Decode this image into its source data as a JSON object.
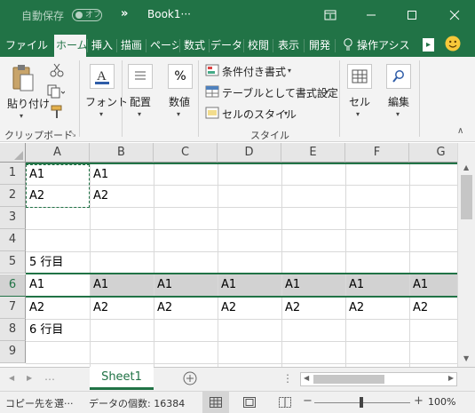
{
  "title_bar": {
    "autosave_label": "自動保存",
    "autosave_state": "オフ",
    "more_label": "»",
    "filename": "Book1···"
  },
  "tabs": [
    "ファイル",
    "ホーム",
    "挿入",
    "描画",
    "ページ",
    "数式",
    "データ",
    "校閲",
    "表示",
    "開発",
    "操作アシス"
  ],
  "ribbon": {
    "paste_label": "貼り付け",
    "font_label": "フォント",
    "align_label": "配置",
    "number_label": "数値",
    "number_icon": "%",
    "cond_format": "条件付き書式",
    "table_format": "テーブルとして書式設定",
    "cell_style": "セルのスタイル",
    "cell_label": "セル",
    "edit_label": "編集",
    "group_clipboard": "クリップボード",
    "group_style": "スタイル"
  },
  "columns": [
    "A",
    "B",
    "C",
    "D",
    "E",
    "F",
    "G"
  ],
  "rows": [
    "1",
    "2",
    "3",
    "4",
    "5",
    "6",
    "7",
    "8",
    "9"
  ],
  "cells": {
    "r1": [
      "A1",
      "A1",
      "",
      "",
      "",
      "",
      ""
    ],
    "r2": [
      "A2",
      "A2",
      "",
      "",
      "",
      "",
      ""
    ],
    "r3": [
      "",
      "",
      "",
      "",
      "",
      "",
      ""
    ],
    "r4": [
      "",
      "",
      "",
      "",
      "",
      "",
      ""
    ],
    "r5": [
      "5 行目",
      "",
      "",
      "",
      "",
      "",
      ""
    ],
    "r6": [
      "A1",
      "A1",
      "A1",
      "A1",
      "A1",
      "A1",
      "A1"
    ],
    "r7": [
      "A2",
      "A2",
      "A2",
      "A2",
      "A2",
      "A2",
      "A2"
    ],
    "r8": [
      "6 行目",
      "",
      "",
      "",
      "",
      "",
      ""
    ],
    "r9": [
      "",
      "",
      "",
      "",
      "",
      "",
      ""
    ]
  },
  "sheet_tab": "Sheet1",
  "status": {
    "mode": "コピー先を選···",
    "count": "データの個数: 16384",
    "zoom": "100%"
  },
  "colors": {
    "accent": "#217346",
    "selected_row": "#d2d2d2"
  }
}
